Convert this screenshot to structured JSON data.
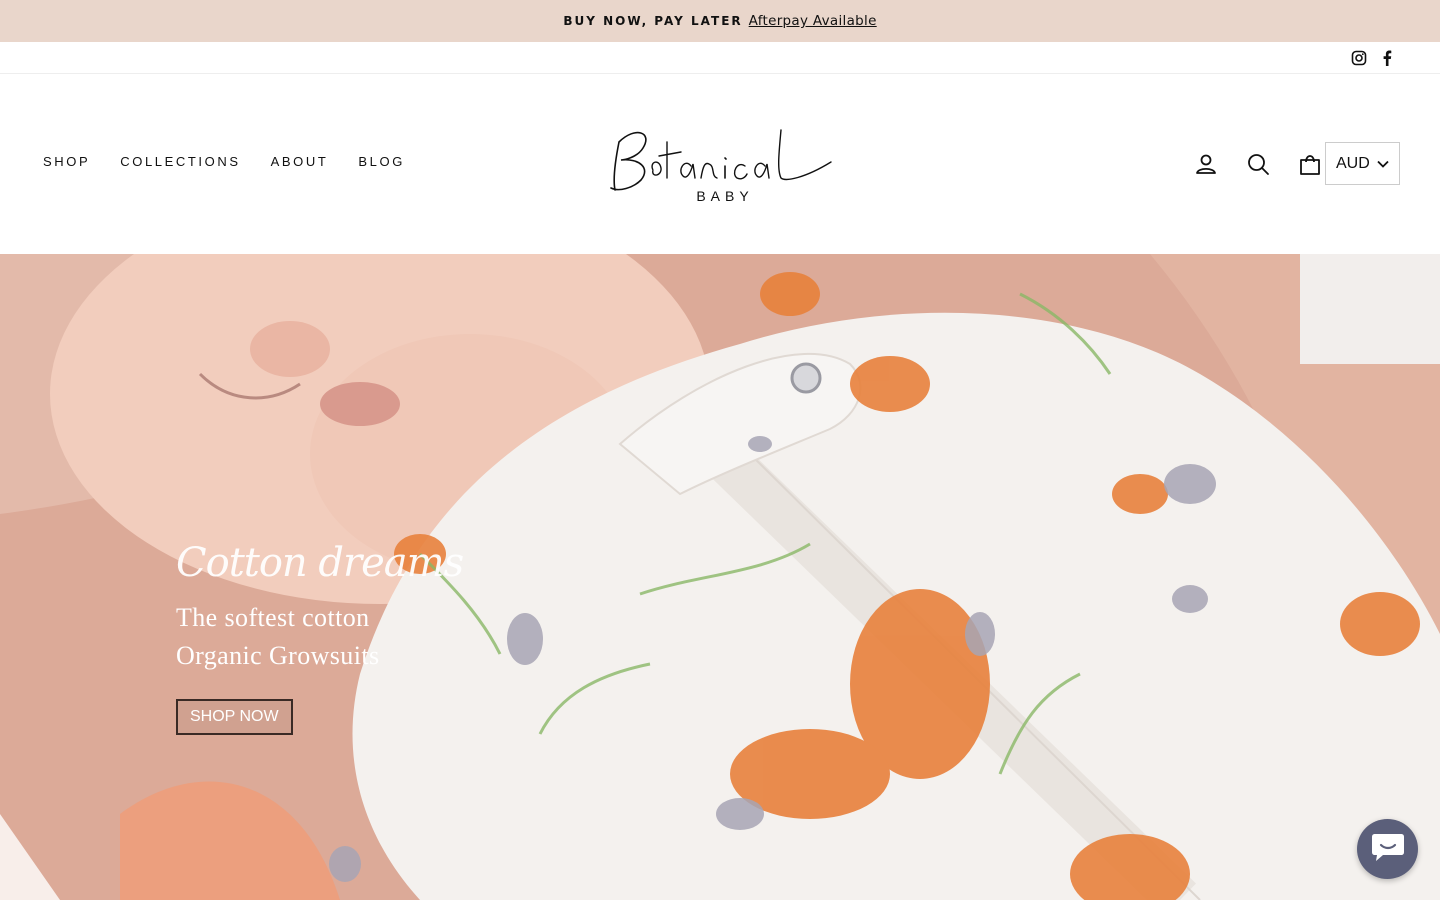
{
  "announcement": {
    "prefix": "BUY NOW, PAY LATER",
    "link": "Afterpay Available"
  },
  "social": [
    {
      "name": "instagram-icon"
    },
    {
      "name": "facebook-icon"
    }
  ],
  "nav": {
    "items": [
      {
        "label": "SHOP"
      },
      {
        "label": "COLLECTIONS"
      },
      {
        "label": "ABOUT"
      },
      {
        "label": "BLOG"
      }
    ]
  },
  "logo": {
    "script": "Botanical",
    "sub": "BABY"
  },
  "header_icons": [
    "account-icon",
    "search-icon",
    "cart-icon"
  ],
  "currency": {
    "selected": "AUD"
  },
  "hero": {
    "eyebrow": "Cotton dreams",
    "title_line1": "The softest cotton",
    "title_line2": "Organic Growsuits",
    "button": "SHOP NOW"
  },
  "chat": {
    "icon": "chat-icon",
    "color": "#5b5f7a"
  },
  "colors": {
    "announcement_bg": "#e9d6cb"
  }
}
